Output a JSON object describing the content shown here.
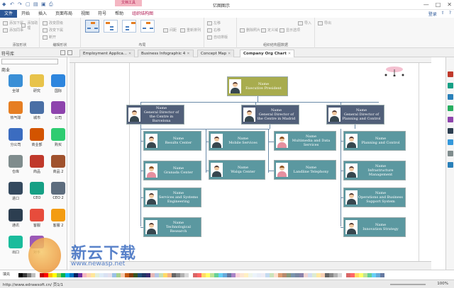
{
  "window": {
    "title": "亿图图示",
    "context_tab": "文档工具",
    "controls": [
      "—",
      "□",
      "✕"
    ]
  },
  "menu": {
    "items": [
      "文件",
      "开始",
      "插入",
      "页面布局",
      "视图",
      "符号",
      "帮助",
      "组织结构图"
    ],
    "right": [
      "登录",
      "⇧",
      "?"
    ]
  },
  "ribbon": {
    "groups": [
      {
        "label": "添加形状",
        "buttons": [
          "添加下属",
          "添加同事",
          "添加助理"
        ]
      },
      {
        "label": "编辑形状",
        "buttons": [
          "改变层级",
          "改变下属",
          "断开"
        ]
      },
      {
        "label": "布局",
        "buttons": [
          "间距",
          "重新排列"
        ]
      },
      {
        "label": "",
        "buttons": [
          "左移",
          "右移",
          "自动排版"
        ]
      },
      {
        "label": "组织结构图数据",
        "buttons": [
          "删除照片",
          "定义域",
          "显示选项",
          "导入",
          "导出"
        ]
      }
    ]
  },
  "library": {
    "title": "符号库",
    "category": "商业",
    "symbols": [
      "全球",
      "研究",
      "国际",
      "热气球",
      "城市",
      "公司",
      "分公司",
      "商业部",
      "购买",
      "仓库",
      "商品",
      "商品 2",
      "进口",
      "CEO",
      "CEO 2",
      "通讯",
      "客服",
      "客服 2",
      "出口",
      "对手"
    ]
  },
  "tabs": [
    {
      "label": "Employment Applica...",
      "active": false
    },
    {
      "label": "Business Infographic 4",
      "active": false
    },
    {
      "label": "Concept Map",
      "active": false
    },
    {
      "label": "Company Org Chart",
      "active": true
    }
  ],
  "org": {
    "top": {
      "name": "Name",
      "title": "Executive President"
    },
    "directors": [
      {
        "name": "Name",
        "title": "General Director of the Centre in Barcelona"
      },
      {
        "name": "Name",
        "title": "General Director of the Centre in Madrid"
      },
      {
        "name": "Name",
        "title": "General Director of Planning and Control"
      }
    ],
    "employees": [
      {
        "name": "Name",
        "title": "Results Center"
      },
      {
        "name": "Name",
        "title": "Granada Center"
      },
      {
        "name": "Name",
        "title": "Services and Systems Engineering"
      },
      {
        "name": "Name",
        "title": "Technological Research"
      },
      {
        "name": "Name",
        "title": "Mobile Services"
      },
      {
        "name": "Name",
        "title": "Walqa Center"
      },
      {
        "name": "Name",
        "title": "Multimedia and Data Services"
      },
      {
        "name": "Name",
        "title": "Landline Telephony"
      },
      {
        "name": "Name",
        "title": "Planning and Control"
      },
      {
        "name": "Name",
        "title": "Infrastructure Management"
      },
      {
        "name": "Name",
        "title": "Operations and Business Support System"
      },
      {
        "name": "Name",
        "title": "Innovation Strategy"
      }
    ]
  },
  "palette": {
    "label": "填充",
    "colors": [
      "#000000",
      "#3a3a3a",
      "#7f7f7f",
      "#bfbfbf",
      "#ffffff",
      "#c00000",
      "#ff0000",
      "#ffc000",
      "#ffff00",
      "#92d050",
      "#00b050",
      "#00b0f0",
      "#0070c0",
      "#002060",
      "#7030a0",
      "#f4b6c2",
      "#fcd5b4",
      "#ffe699",
      "#e2efda",
      "#ddebf7",
      "#d9e1f2",
      "#e4dfec",
      "#9bc2e6",
      "#a9d08e",
      "#f8cbad",
      "#c65911",
      "#833c0c",
      "#375623",
      "#1f4e78",
      "#203764",
      "#3a2c70",
      "#e6b8b7",
      "#b4c6e7",
      "#c6e0b4",
      "#ffd966",
      "#f4b084"
    ]
  },
  "status": {
    "url": "http://www.edrawsoft.cn/",
    "page": "页1/1",
    "zoom": "100%"
  },
  "watermark": {
    "text": "新云下载",
    "url": "www.newasp.net"
  }
}
